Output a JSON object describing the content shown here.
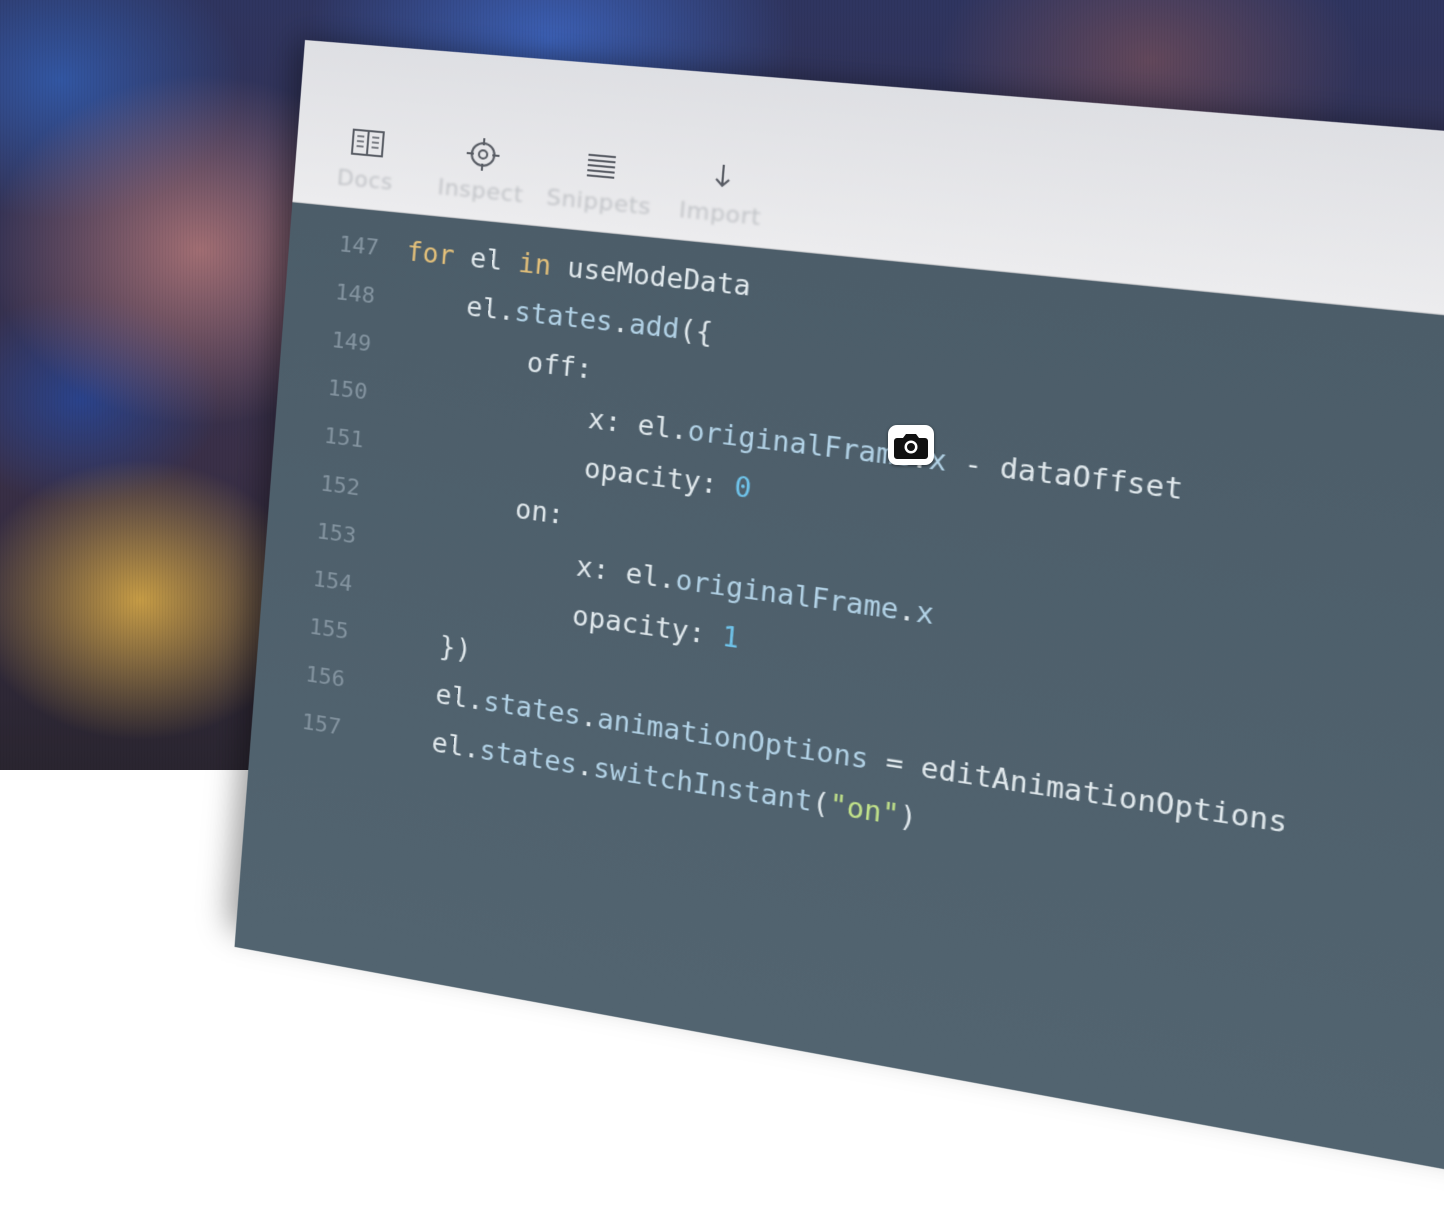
{
  "toolbar": {
    "buttons": [
      {
        "label": "Docs",
        "icon": "book-icon"
      },
      {
        "label": "Inspect",
        "icon": "crosshair-icon"
      },
      {
        "label": "Snippets",
        "icon": "list-icon"
      },
      {
        "label": "Import",
        "icon": "arrow-down-icon"
      }
    ]
  },
  "editor": {
    "lines": [
      {
        "number": "147",
        "tokens": [
          [
            "for",
            "kw"
          ],
          [
            " el ",
            "op"
          ],
          [
            "in",
            "kw"
          ],
          [
            " useModeData",
            "op"
          ]
        ]
      },
      {
        "number": "148",
        "tokens": [
          [
            "    el.",
            "op"
          ],
          [
            "states",
            "prop"
          ],
          [
            ".",
            "op"
          ],
          [
            "add",
            "prop"
          ],
          [
            "({",
            "op"
          ]
        ]
      },
      {
        "number": "149",
        "tokens": [
          [
            "        off:",
            "op"
          ]
        ]
      },
      {
        "number": "150",
        "tokens": [
          [
            "            x: el.",
            "op"
          ],
          [
            "originalFrame",
            "prop"
          ],
          [
            ".",
            "op"
          ],
          [
            "x",
            "prop"
          ],
          [
            " - dataOffset",
            "op"
          ]
        ]
      },
      {
        "number": "151",
        "tokens": [
          [
            "            opacity: ",
            "op"
          ],
          [
            "0",
            "num"
          ]
        ]
      },
      {
        "number": "152",
        "tokens": [
          [
            "        on:",
            "op"
          ]
        ]
      },
      {
        "number": "153",
        "tokens": [
          [
            "            x: el.",
            "op"
          ],
          [
            "originalFrame",
            "prop"
          ],
          [
            ".",
            "op"
          ],
          [
            "x",
            "prop"
          ]
        ]
      },
      {
        "number": "154",
        "tokens": [
          [
            "            opacity: ",
            "op"
          ],
          [
            "1",
            "num"
          ]
        ]
      },
      {
        "number": "155",
        "tokens": [
          [
            "    })",
            "op"
          ]
        ]
      },
      {
        "number": "156",
        "tokens": [
          [
            "    el.",
            "op"
          ],
          [
            "states",
            "prop"
          ],
          [
            ".",
            "op"
          ],
          [
            "animationOptions",
            "prop"
          ],
          [
            " = editAnimationOptions",
            "op"
          ]
        ]
      },
      {
        "number": "157",
        "tokens": [
          [
            "    el.",
            "op"
          ],
          [
            "states",
            "prop"
          ],
          [
            ".",
            "op"
          ],
          [
            "switchInstant",
            "prop"
          ],
          [
            "(",
            "op"
          ],
          [
            "\"on\"",
            "str"
          ],
          [
            ")",
            "op"
          ]
        ]
      }
    ]
  },
  "overlay": {
    "icon": "camera-icon"
  },
  "colors": {
    "keyword": "#e3c07a",
    "property": "#b2d2e6",
    "number": "#6fc3ea",
    "string": "#c2e38a",
    "editor_bg": "#4c5d69",
    "toolbar_bg": "#e6e7ea"
  }
}
